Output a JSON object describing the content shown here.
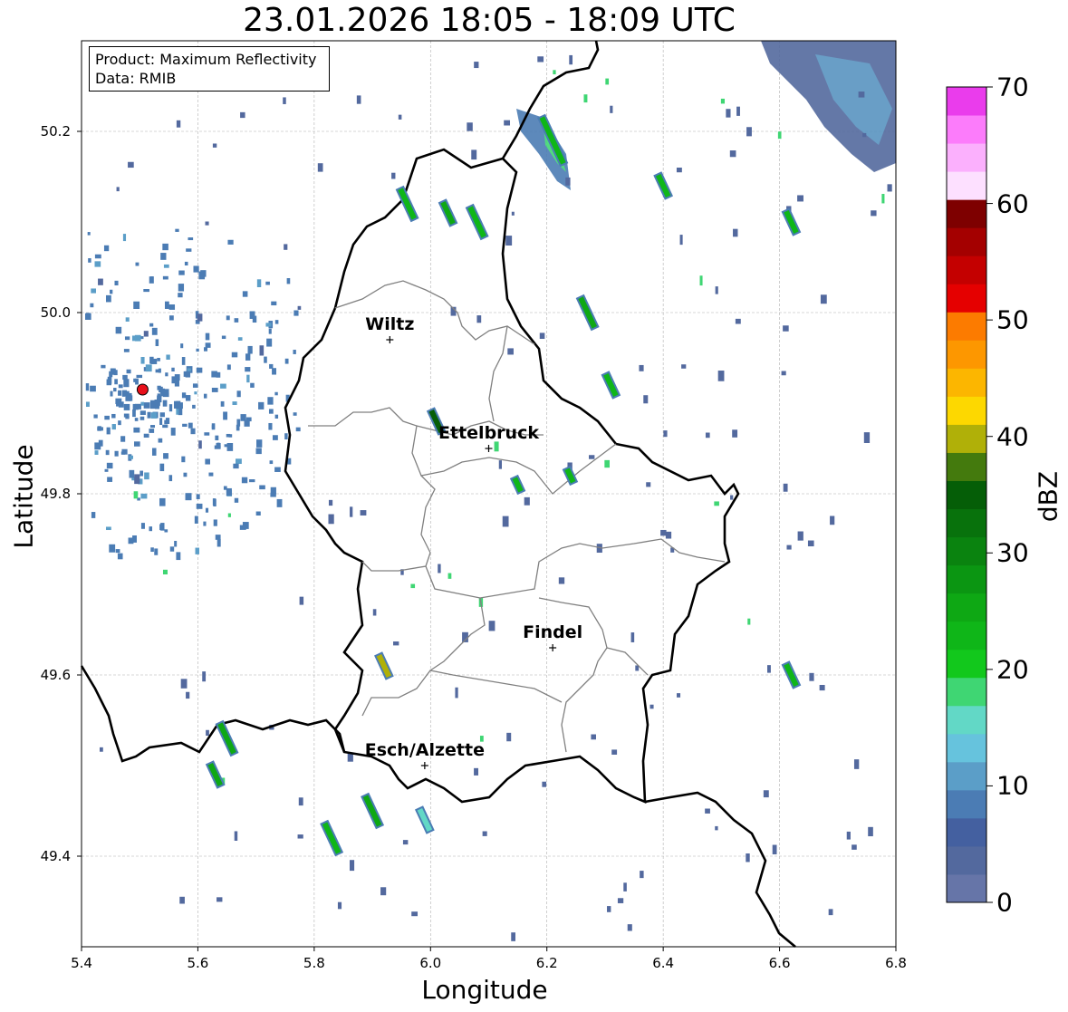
{
  "title": "23.01.2026 18:05 - 18:09 UTC",
  "info": {
    "product": "Product: Maximum Reflectivity",
    "data": "Data: RMIB"
  },
  "axes": {
    "xlabel": "Longitude",
    "ylabel": "Latitude",
    "xlim": [
      5.4,
      6.8
    ],
    "ylim": [
      49.3,
      50.3
    ],
    "xticks": [
      "5.4",
      "5.6",
      "5.8",
      "6.0",
      "6.2",
      "6.4",
      "6.6",
      "6.8"
    ],
    "yticks": [
      "49.4",
      "49.6",
      "49.8",
      "50.0",
      "50.2"
    ],
    "grid": true
  },
  "colorbar": {
    "label": "dBZ",
    "range": [
      0,
      70
    ],
    "ticks": [
      "0",
      "10",
      "20",
      "30",
      "40",
      "50",
      "60",
      "70"
    ],
    "colors": [
      "#6675a8",
      "#53699e",
      "#4460a0",
      "#4b7cb4",
      "#5b9ec8",
      "#66c3dd",
      "#62d8c6",
      "#3fd673",
      "#12c81c",
      "#0fb618",
      "#0ea814",
      "#0b9612",
      "#0a830f",
      "#08720c",
      "#055e07",
      "#447a0d",
      "#b0b008",
      "#fdd800",
      "#fcb600",
      "#fd9700",
      "#fc7b00",
      "#e50000",
      "#c40000",
      "#a40000",
      "#7e0000",
      "#fde0ff",
      "#fbb0fd",
      "#fc7cfb",
      "#ea3cec"
    ]
  },
  "cities": [
    {
      "name": "Wiltz",
      "lon": 5.93,
      "lat": 49.97
    },
    {
      "name": "Ettelbruck",
      "lon": 6.1,
      "lat": 49.85
    },
    {
      "name": "Findel",
      "lon": 6.21,
      "lat": 49.63
    },
    {
      "name": "Esch/Alzette",
      "lon": 5.99,
      "lat": 49.5
    }
  ],
  "radar_site": {
    "lon": 5.505,
    "lat": 49.915,
    "color": "#e8101a"
  },
  "colors": {
    "border": "#000000",
    "canton_lines": "#808080",
    "grid": "#b0b0b0"
  },
  "echoes": [
    {
      "lon": 5.96,
      "lat": 50.12,
      "dbz": 22,
      "len": 0.04
    },
    {
      "lon": 6.03,
      "lat": 50.11,
      "dbz": 25,
      "len": 0.03
    },
    {
      "lon": 6.08,
      "lat": 50.1,
      "dbz": 22,
      "len": 0.04
    },
    {
      "lon": 6.21,
      "lat": 50.19,
      "dbz": 22,
      "len": 0.06
    },
    {
      "lon": 6.27,
      "lat": 50.0,
      "dbz": 25,
      "len": 0.04
    },
    {
      "lon": 6.31,
      "lat": 49.92,
      "dbz": 22,
      "len": 0.03
    },
    {
      "lon": 6.01,
      "lat": 49.88,
      "dbz": 35,
      "len": 0.03
    },
    {
      "lon": 6.24,
      "lat": 49.82,
      "dbz": 22,
      "len": 0.02
    },
    {
      "lon": 5.92,
      "lat": 49.61,
      "dbz": 40,
      "len": 0.03
    },
    {
      "lon": 6.62,
      "lat": 49.6,
      "dbz": 22,
      "len": 0.03
    },
    {
      "lon": 5.83,
      "lat": 49.42,
      "dbz": 22,
      "len": 0.04
    },
    {
      "lon": 5.9,
      "lat": 49.45,
      "dbz": 25,
      "len": 0.04
    },
    {
      "lon": 5.65,
      "lat": 49.53,
      "dbz": 25,
      "len": 0.04
    },
    {
      "lon": 5.63,
      "lat": 49.49,
      "dbz": 25,
      "len": 0.03
    },
    {
      "lon": 6.62,
      "lat": 50.1,
      "dbz": 22,
      "len": 0.03
    },
    {
      "lon": 6.4,
      "lat": 50.14,
      "dbz": 22,
      "len": 0.03
    },
    {
      "lon": 6.15,
      "lat": 49.81,
      "dbz": 22,
      "len": 0.02
    },
    {
      "lon": 5.99,
      "lat": 49.44,
      "dbz": 15,
      "len": 0.03
    }
  ]
}
